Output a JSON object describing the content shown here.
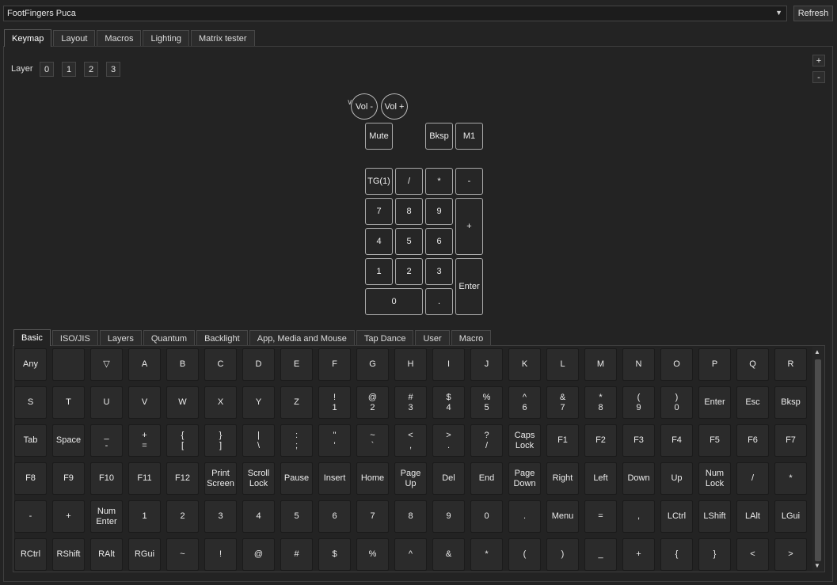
{
  "device": {
    "name": "FootFingers Puca",
    "refresh_label": "Refresh"
  },
  "main_tabs": [
    "Keymap",
    "Layout",
    "Macros",
    "Lighting",
    "Matrix tester"
  ],
  "layers": {
    "label": "Layer",
    "items": [
      "0",
      "1",
      "2",
      "3"
    ]
  },
  "layer_controls": {
    "add": "+",
    "remove": "-"
  },
  "encoders": [
    "Vol -",
    "Vol +"
  ],
  "keymap_keys": [
    "Mute",
    "Bksp",
    "M1",
    "TG(1)",
    "/",
    "*",
    "-",
    "7",
    "8",
    "9",
    "+",
    "4",
    "5",
    "6",
    "1",
    "2",
    "3",
    "Enter",
    "0",
    "."
  ],
  "sub_tabs": [
    "Basic",
    "ISO/JIS",
    "Layers",
    "Quantum",
    "Backlight",
    "App, Media and Mouse",
    "Tap Dance",
    "User",
    "Macro"
  ],
  "basic_keys": [
    "Any",
    "",
    "▽",
    "A",
    "B",
    "C",
    "D",
    "E",
    "F",
    "G",
    "H",
    "I",
    "J",
    "K",
    "L",
    "M",
    "N",
    "O",
    "P",
    "Q",
    "R",
    "S",
    "T",
    "U",
    "V",
    "W",
    "X",
    "Y",
    "Z",
    "!\n1",
    "@\n2",
    "#\n3",
    "$\n4",
    "%\n5",
    "^\n6",
    "&\n7",
    "*\n8",
    "(\n9",
    ")\n0",
    "Enter",
    "Esc",
    "Bksp",
    "Tab",
    "Space",
    "_\n-",
    "+\n=",
    "{\n[",
    "}\n]",
    "|\n\\",
    ":\n;",
    "\"\n'",
    "~\n`",
    "<\n,",
    ">\n.",
    "?\n/",
    "Caps\nLock",
    "F1",
    "F2",
    "F3",
    "F4",
    "F5",
    "F6",
    "F7",
    "F8",
    "F9",
    "F10",
    "F11",
    "F12",
    "Print\nScreen",
    "Scroll\nLock",
    "Pause",
    "Insert",
    "Home",
    "Page\nUp",
    "Del",
    "End",
    "Page\nDown",
    "Right",
    "Left",
    "Down",
    "Up",
    "Num\nLock",
    "/",
    "*",
    "-",
    "+",
    "Num\nEnter",
    "1",
    "2",
    "3",
    "4",
    "5",
    "6",
    "7",
    "8",
    "9",
    "0",
    ".",
    "Menu",
    "=",
    ",",
    "LCtrl",
    "LShift",
    "LAlt",
    "LGui",
    "RCtrl",
    "RShift",
    "RAlt",
    "RGui",
    "~",
    "!",
    "@",
    "#",
    "$",
    "%",
    "^",
    "&",
    "*",
    "(",
    ")",
    "_",
    "+",
    "{",
    "}",
    "<",
    ">"
  ],
  "icons": {
    "dropdown": "chevron-down-icon",
    "scroll_up": "arrow-up-icon",
    "scroll_down": "arrow-down-icon"
  }
}
